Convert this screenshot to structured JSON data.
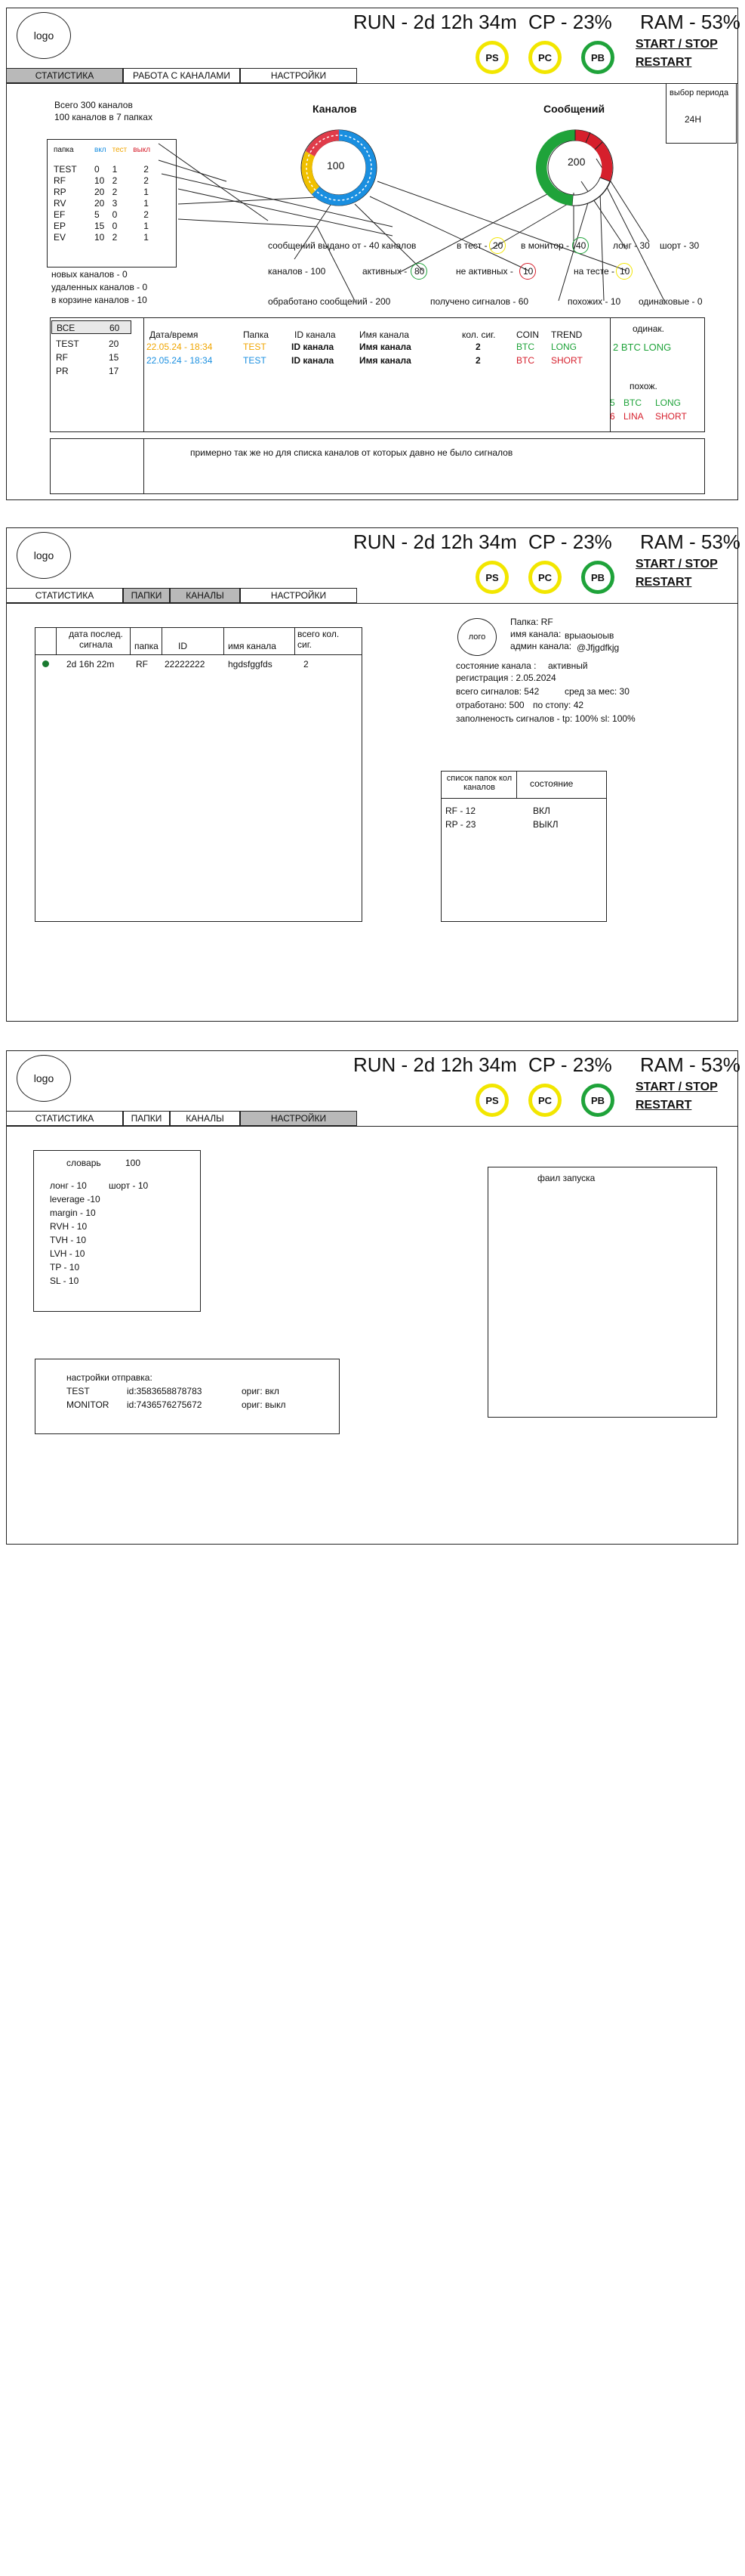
{
  "header": {
    "logo": "logo",
    "run": "RUN - 2d 12h 34m",
    "cp": "CP - 23%",
    "ram": "RAM - 53%",
    "ps": "PS",
    "pc": "PC",
    "pb": "PB",
    "start_stop": "START / STOP",
    "restart": "RESTART"
  },
  "screen1": {
    "tabs": [
      "СТАТИСТИКА",
      "РАБОТА С КАНАЛАМИ",
      "НАСТРОЙКИ"
    ],
    "period_label": "выбор периода",
    "period_value": "24Н",
    "totals_line1": "Всего 300 каналов",
    "totals_line2": "100 каналов в 7 папках",
    "folders_header": [
      "папка",
      "вкл",
      "тест",
      "выкл"
    ],
    "folders": [
      [
        "TEST",
        "0",
        "1",
        "2"
      ],
      [
        "RF",
        "10",
        "2",
        "2"
      ],
      [
        "RP",
        "20",
        "2",
        "1"
      ],
      [
        "RV",
        "20",
        "3",
        "1"
      ],
      [
        "EF",
        "5",
        "0",
        "2"
      ],
      [
        "EP",
        "15",
        "0",
        "1"
      ],
      [
        "EV",
        "10",
        "2",
        "1"
      ]
    ],
    "new_channels": "новых каналов - 0",
    "deleted_channels": "удаленных каналов - 0",
    "trash_channels": "в корзине каналов - 10",
    "channels_chart_title": "Каналов",
    "channels_chart_value": "100",
    "messages_chart_title": "Сообщений",
    "messages_chart_value": "200",
    "signals_given": "сообщений выдано от - 40 каналов",
    "in_test": "в тест -",
    "in_test_n": "20",
    "in_monitor": "в монитор -",
    "in_monitor_n": "40",
    "long": "лонг - 30",
    "short": "шорт - 30",
    "channels_total": "каналов - 100",
    "active": "активных -",
    "active_n": "80",
    "inactive": "не активных -",
    "inactive_n": "10",
    "on_test": "на тесте -",
    "on_test_n": "10",
    "processed": "обработано сообщений - 200",
    "received": "получено сигналов - 60",
    "similar": "похожих - 10",
    "same": "одинаковые - 0",
    "filter_header": [
      "ВСЕ",
      "60"
    ],
    "filter_rows": [
      [
        "TEST",
        "20"
      ],
      [
        "RF",
        "15"
      ],
      [
        "PR",
        "17"
      ]
    ],
    "signals_header": [
      "Дата/время",
      "Папка",
      "ID канала",
      "Имя канала",
      "кол. сиг.",
      "COIN",
      "TREND"
    ],
    "signals_rows": [
      [
        "22.05.24 - 18:34",
        "TEST",
        "ID канала",
        "Имя канала",
        "2",
        "BTC",
        "LONG"
      ],
      [
        "22.05.24 - 18:34",
        "TEST",
        "ID канала",
        "Имя канала",
        "2",
        "BTC",
        "SHORT"
      ]
    ],
    "same_title": "одинак.",
    "same_item": "2 BTC LONG",
    "similar_title": "похож.",
    "similar_items": [
      [
        "5",
        "BTC",
        "LONG"
      ],
      [
        "6",
        "LINA",
        "SHORT"
      ]
    ],
    "note": "примерно так же но для списка каналов от которых давно не было сигналов"
  },
  "screen2": {
    "tabs": [
      "СТАТИСТИКА",
      "ПАПКИ",
      "КАНАЛЫ",
      "НАСТРОЙКИ"
    ],
    "table_header": [
      "дата послед. сигнала",
      "папка",
      "ID",
      "имя канала",
      "всего кол. сиг."
    ],
    "table_row": [
      "2d 16h 22m",
      "RF",
      "22222222",
      "hgdsfggfds",
      "2"
    ],
    "logo": "лого",
    "folder": "Папка: RF",
    "channel_name_label": "имя канала:",
    "channel_name": "врыаоыоыв",
    "admin_label": "админ канала:",
    "admin": "@Jfjgdfkjg",
    "state_label": "состояние канала :",
    "state": "активный",
    "registration": "регистрация : 2.05.2024",
    "total_signals": "всего сигналов: 542",
    "avg_month": "сред за мес: 30",
    "worked": "отработано: 500",
    "by_stop": "по стопу: 42",
    "fill": "заполненость сигналов - tp: 100%   sl: 100%",
    "list_header_1": "список папок кол каналов",
    "list_header_2": "состояние",
    "list_rows": [
      [
        "RF - 12",
        "ВКЛ"
      ],
      [
        "RP - 23",
        "ВЫКЛ"
      ]
    ]
  },
  "screen3": {
    "tabs": [
      "СТАТИСТИКА",
      "ПАПКИ",
      "КАНАЛЫ",
      "НАСТРОЙКИ"
    ],
    "dict_label": "словарь",
    "dict_value": "100",
    "dict_long": "лонг -  10",
    "dict_short": "шорт - 10",
    "dict_items": [
      "leverage -10",
      "margin - 10",
      "RVH - 10",
      "TVH - 10",
      "LVH - 10",
      "TP - 10",
      "SL - 10"
    ],
    "send_title": "настройки отправка:",
    "send_rows": [
      [
        "TEST",
        "id:3583658878783",
        "ориг: вкл"
      ],
      [
        "MONITOR",
        "id:7436576275672",
        "ориг: выкл"
      ]
    ],
    "launch_file": "фаил запуска"
  }
}
